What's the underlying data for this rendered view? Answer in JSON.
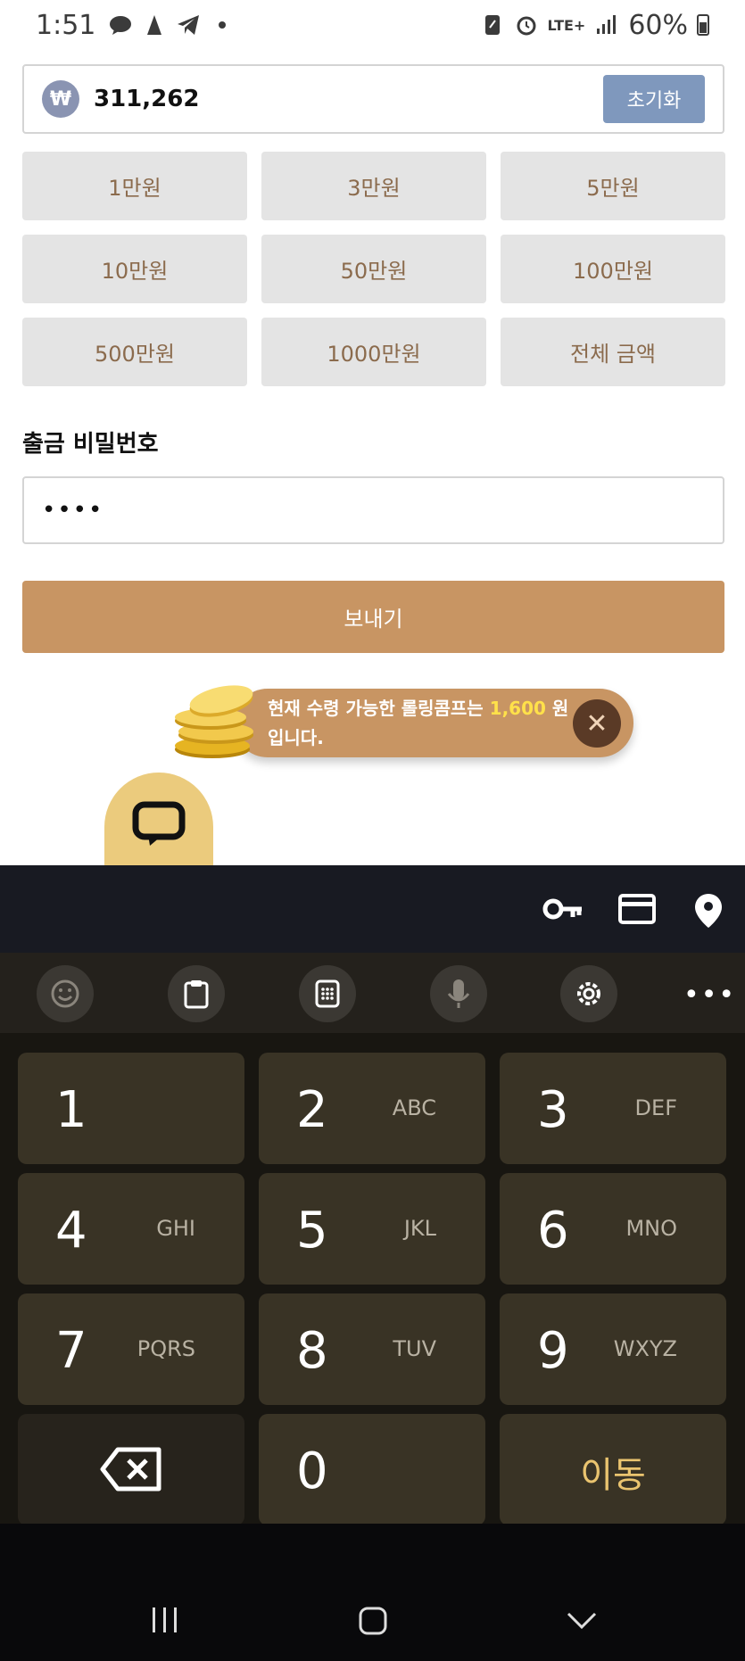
{
  "status_bar": {
    "time": "1:51",
    "network": "LTE+",
    "battery": "60%"
  },
  "amount": {
    "currency_symbol": "₩",
    "value": "311,262",
    "reset_label": "초기화"
  },
  "quick_amounts": [
    "1만원",
    "3만원",
    "5만원",
    "10만원",
    "50만원",
    "100만원",
    "500만원",
    "1000만원",
    "전체 금액"
  ],
  "password": {
    "label": "출금 비밀번호",
    "masked_value": "••••"
  },
  "send_label": "보내기",
  "comp_banner": {
    "text_before": "현재 수령 가능한 롤링콤프는 ",
    "amount": "1,600",
    "text_after": " 원 입니다."
  },
  "keyboard": {
    "keys": [
      {
        "num": "1",
        "letters": ""
      },
      {
        "num": "2",
        "letters": "ABC"
      },
      {
        "num": "3",
        "letters": "DEF"
      },
      {
        "num": "4",
        "letters": "GHI"
      },
      {
        "num": "5",
        "letters": "JKL"
      },
      {
        "num": "6",
        "letters": "MNO"
      },
      {
        "num": "7",
        "letters": "PQRS"
      },
      {
        "num": "8",
        "letters": "TUV"
      },
      {
        "num": "9",
        "letters": "WXYZ"
      }
    ],
    "zero": "0",
    "go_label": "이동"
  }
}
